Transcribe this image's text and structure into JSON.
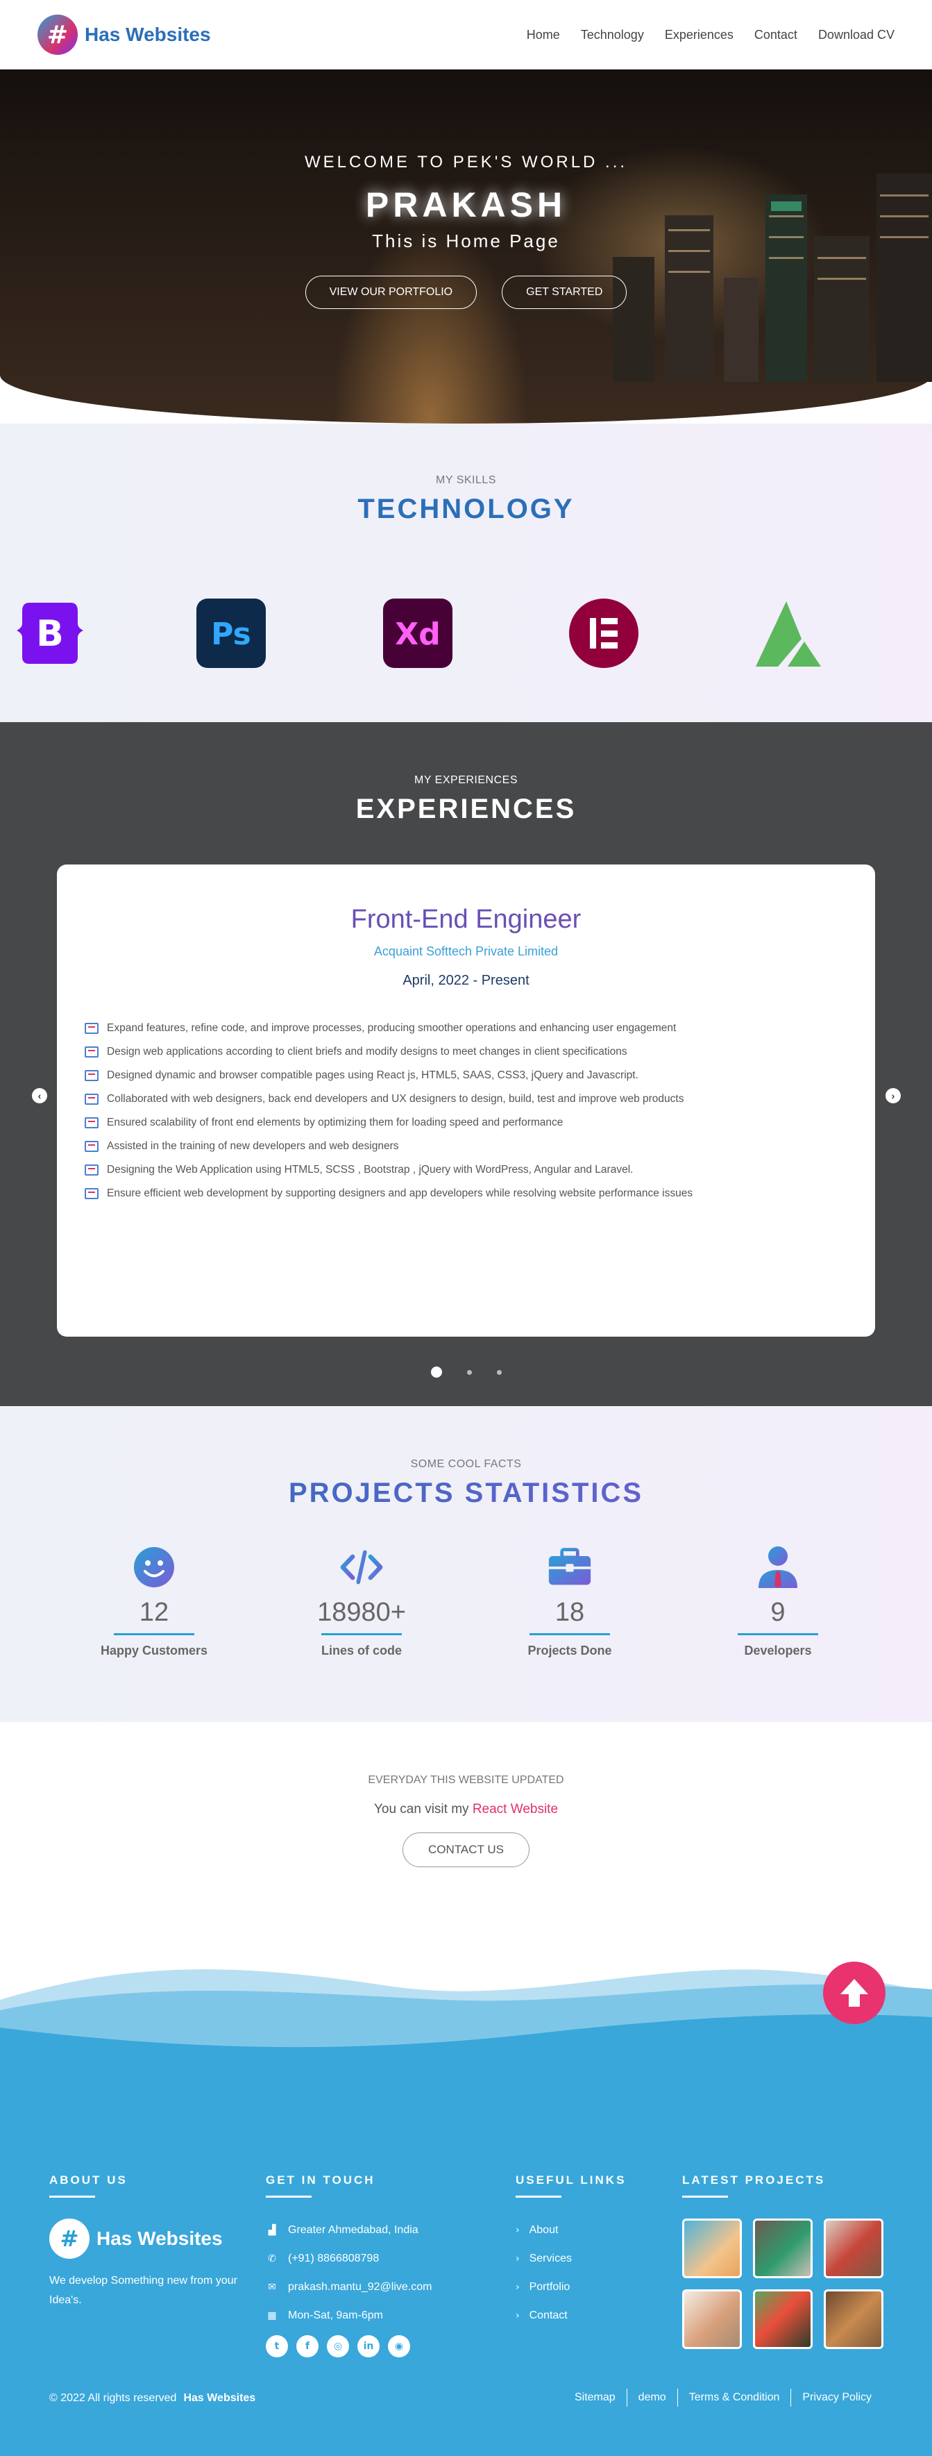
{
  "header": {
    "brand": "Has Websites",
    "logo_glyph": "#",
    "nav": [
      "Home",
      "Technology",
      "Experiences",
      "Contact",
      "Download CV"
    ]
  },
  "hero": {
    "welcome": "WELCOME TO PEK'S WORLD ...",
    "name": "PRAKASH",
    "subtitle": "This is Home Page",
    "buttons": [
      "VIEW OUR PORTFOLIO",
      "GET STARTED"
    ]
  },
  "technology": {
    "kicker": "MY SKILLS",
    "title": "TECHNOLOGY",
    "icons": [
      {
        "name": "bootstrap-icon",
        "glyph": "B",
        "color": "#7a12f0"
      },
      {
        "name": "photoshop-icon",
        "glyph": "Ps",
        "color": "#0d2a4a"
      },
      {
        "name": "adobe-xd-icon",
        "glyph": "Xd",
        "color": "#470137"
      },
      {
        "name": "elementor-icon",
        "glyph": "E",
        "color": "#92003b"
      },
      {
        "name": "avocode-icon",
        "glyph": "",
        "color": "#5cb85c"
      }
    ]
  },
  "experiences": {
    "kicker": "MY EXPERIENCES",
    "title": "EXPERIENCES",
    "job": {
      "title": "Front-End Engineer",
      "company": "Acquaint Softtech Private Limited",
      "date": "April, 2022 - Present",
      "items": [
        "Expand features, refine code, and improve processes, producing smoother operations and enhancing user engagement",
        "Design web applications according to client briefs and modify designs to meet changes in client specifications",
        "Designed dynamic and browser compatible pages using React js, HTML5, SAAS, CSS3, jQuery and Javascript.",
        "Collaborated with web designers, back end developers and UX designers to design, build, test and improve web products",
        "Ensured scalability of front end elements by optimizing them for loading speed and performance",
        "Assisted in the training of new developers and web designers",
        "Designing the Web Application using HTML5, SCSS , Bootstrap , jQuery with WordPress, Angular and Laravel.",
        "Ensure efficient web development by supporting designers and app developers while resolving website performance issues"
      ]
    },
    "prev_glyph": "‹",
    "next_glyph": "›",
    "slides": 3,
    "active_slide": 1
  },
  "stats": {
    "kicker": "SOME COOL FACTS",
    "title": "PROJECTS STATISTICS",
    "items": [
      {
        "value": "12",
        "label": "Happy Customers",
        "icon": "smile-icon"
      },
      {
        "value": "18980+",
        "label": "Lines of code",
        "icon": "code-icon"
      },
      {
        "value": "18",
        "label": "Projects Done",
        "icon": "briefcase-icon"
      },
      {
        "value": "9",
        "label": "Developers",
        "icon": "developer-icon"
      }
    ]
  },
  "cta": {
    "kicker": "EVERYDAY THIS WEBSITE UPDATED",
    "text": "You can visit my",
    "link": "React Website",
    "button": "CONTACT US"
  },
  "footer": {
    "about": {
      "heading": "ABOUT US",
      "brand": "Has Websites",
      "logo_glyph": "#",
      "desc": "We develop Something new from your Idea's."
    },
    "contact": {
      "heading": "GET IN TOUCH",
      "rows": [
        {
          "icon": "building-icon",
          "glyph": "▟",
          "text": "Greater Ahmedabad, India"
        },
        {
          "icon": "phone-icon",
          "glyph": "✆",
          "text": "(+91) 8866808798"
        },
        {
          "icon": "mail-icon",
          "glyph": "✉",
          "text": "prakash.mantu_92@live.com"
        },
        {
          "icon": "calendar-icon",
          "glyph": "▦",
          "text": "Mon-Sat, 9am-6pm"
        }
      ],
      "socials": [
        {
          "icon": "twitter-icon",
          "glyph": "t"
        },
        {
          "icon": "facebook-icon",
          "glyph": "f"
        },
        {
          "icon": "instagram-icon",
          "glyph": "◎"
        },
        {
          "icon": "linkedin-icon",
          "glyph": "in"
        },
        {
          "icon": "github-icon",
          "glyph": "◉"
        }
      ]
    },
    "useful": {
      "heading": "USEFUL LINKS",
      "links": [
        "About",
        "Services",
        "Portfolio",
        "Contact"
      ],
      "chevron": "›"
    },
    "projects": {
      "heading": "LATEST PROJECTS",
      "count": 6
    },
    "copyright": "© 2022 All rights reserved",
    "copyright_brand": "Has Websites",
    "legal": [
      "Sitemap",
      "demo",
      "Terms & Condition",
      "Privacy Policy"
    ]
  },
  "colors": {
    "brand_blue": "#2a6fb8",
    "accent_pink": "#e8336e",
    "footer_blue": "#39a7da",
    "experience_bg": "#474849"
  }
}
